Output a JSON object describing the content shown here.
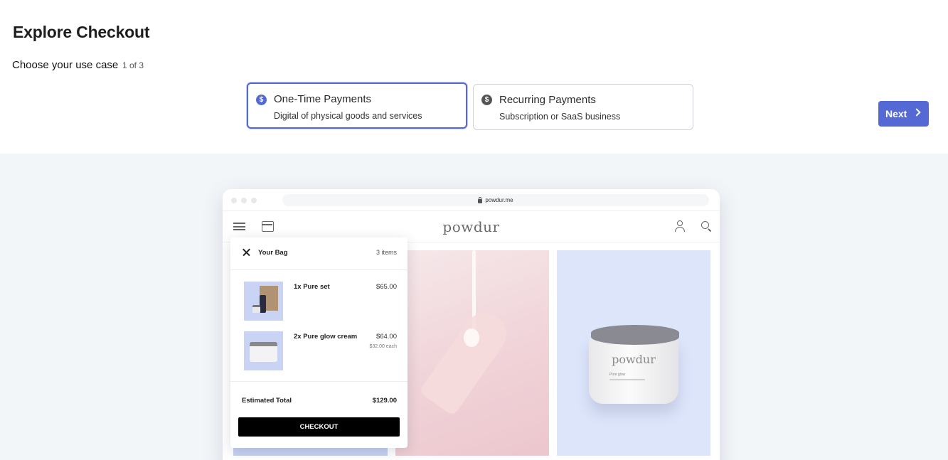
{
  "header": {
    "title": "Explore Checkout",
    "subtitle": "Choose your use case",
    "step": "1 of 3"
  },
  "options": [
    {
      "title": "One-Time Payments",
      "description": "Digital of physical goods and services",
      "icon": "dollar-icon",
      "selected": true
    },
    {
      "title": "Recurring Payments",
      "description": "Subscription or SaaS business",
      "icon": "dollar-icon",
      "selected": false
    }
  ],
  "next_label": "Next",
  "colors": {
    "accent": "#5469d4",
    "preview_bg": "#f3f6f9"
  },
  "preview": {
    "url": "powdur.me",
    "brand": "powdur",
    "jar_label": "Pure glow",
    "bag": {
      "title": "Your Bag",
      "count": "3 items",
      "items": [
        {
          "name": "1x Pure set",
          "price": "$65.00",
          "each": ""
        },
        {
          "name": "2x Pure glow cream",
          "price": "$64.00",
          "each": "$32.00 each"
        }
      ],
      "total_label": "Estimated Total",
      "total_value": "$129.00",
      "checkout_label": "CHECKOUT"
    }
  }
}
